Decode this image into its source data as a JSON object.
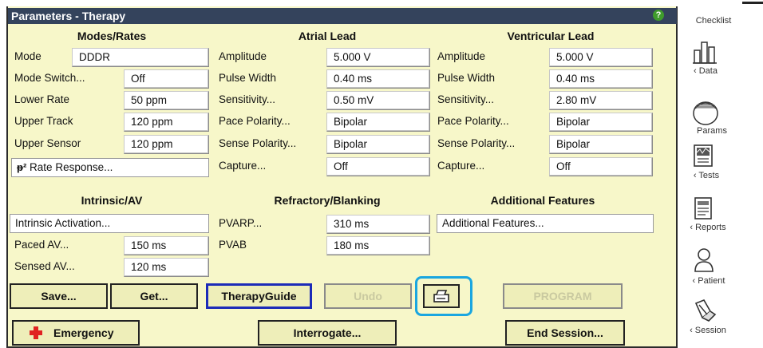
{
  "title": "Parameters - Therapy",
  "help_icon": "question-icon",
  "sections": {
    "modes_rates": "Modes/Rates",
    "atrial_lead": "Atrial Lead",
    "ventricular_lead": "Ventricular Lead",
    "intrinsic_av": "Intrinsic/AV",
    "refractory_blanking": "Refractory/Blanking",
    "additional_features": "Additional Features"
  },
  "modes": {
    "mode_label": "Mode",
    "mode_value": "DDDR",
    "mode_switch_label": "Mode Switch...",
    "mode_switch_value": "Off",
    "lower_rate_label": "Lower Rate",
    "lower_rate_value": "50 ppm",
    "upper_track_label": "Upper Track",
    "upper_track_value": "120 ppm",
    "upper_sensor_label": "Upper Sensor",
    "upper_sensor_value": "120 ppm",
    "rate_response_label": "Rate Response..."
  },
  "atrial": {
    "amplitude_label": "Amplitude",
    "amplitude_value": "5.000 V",
    "pulse_width_label": "Pulse Width",
    "pulse_width_value": "0.40 ms",
    "sensitivity_label": "Sensitivity...",
    "sensitivity_value": "0.50 mV",
    "pace_polarity_label": "Pace Polarity...",
    "pace_polarity_value": "Bipolar",
    "sense_polarity_label": "Sense Polarity...",
    "sense_polarity_value": "Bipolar",
    "capture_label": "Capture...",
    "capture_value": "Off"
  },
  "ventricular": {
    "amplitude_label": "Amplitude",
    "amplitude_value": "5.000 V",
    "pulse_width_label": "Pulse Width",
    "pulse_width_value": "0.40 ms",
    "sensitivity_label": "Sensitivity...",
    "sensitivity_value": "2.80 mV",
    "pace_polarity_label": "Pace Polarity...",
    "pace_polarity_value": "Bipolar",
    "sense_polarity_label": "Sense Polarity...",
    "sense_polarity_value": "Bipolar",
    "capture_label": "Capture...",
    "capture_value": "Off"
  },
  "intrinsic": {
    "activation_label": "Intrinsic Activation...",
    "paced_av_label": "Paced AV...",
    "paced_av_value": "150 ms",
    "sensed_av_label": "Sensed AV...",
    "sensed_av_value": "120 ms"
  },
  "refractory": {
    "pvarp_label": "PVARP...",
    "pvarp_value": "310 ms",
    "pvab_label": "PVAB",
    "pvab_value": "180 ms"
  },
  "additional": {
    "features_label": "Additional Features..."
  },
  "buttons": {
    "save": "Save...",
    "get": "Get...",
    "therapy_guide": "TherapyGuide",
    "undo": "Undo",
    "print_icon": "printer-icon",
    "program": "PROGRAM",
    "emergency": "Emergency",
    "interrogate": "Interrogate...",
    "end_session": "End Session..."
  },
  "sidebar": {
    "checklist": "Checklist",
    "data": "‹ Data",
    "params": "Params",
    "tests": "‹ Tests",
    "reports": "‹ Reports",
    "patient": "‹ Patient",
    "session": "‹ Session"
  },
  "colors": {
    "panel": "#f7f7c9",
    "title_bar": "#34435c",
    "highlight": "#1aa6e0",
    "selected_border": "#1c2bb8"
  }
}
